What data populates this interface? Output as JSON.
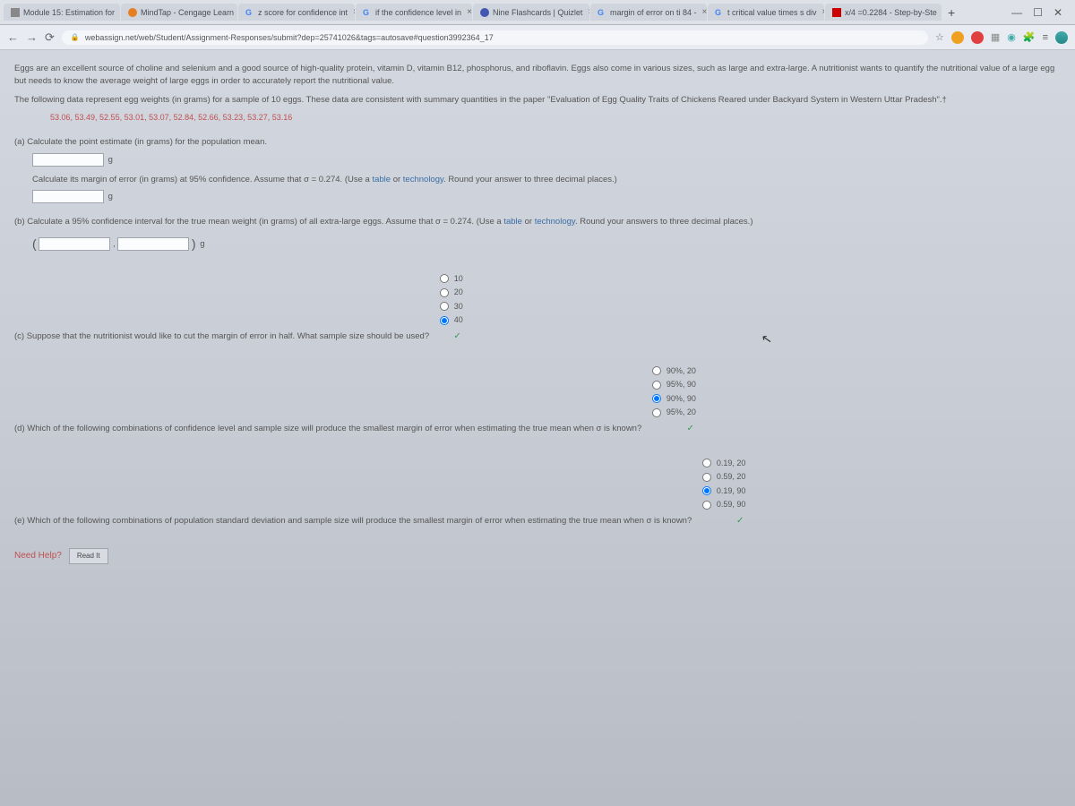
{
  "tabs": [
    {
      "label": "Module 15: Estimation for",
      "icon_color": "#888",
      "icon_shape": "square"
    },
    {
      "label": "MindTap - Cengage Learn",
      "icon_color": "#e67e22",
      "icon_shape": "star"
    },
    {
      "label": "z score for confidence int",
      "icon_color": "#4285f4",
      "icon_shape": "g"
    },
    {
      "label": "if the confidence level in",
      "icon_color": "#4285f4",
      "icon_shape": "g"
    },
    {
      "label": "Nine Flashcards | Quizlet",
      "icon_color": "#4257b2",
      "icon_shape": "q"
    },
    {
      "label": "margin of error on ti 84 -",
      "icon_color": "#4285f4",
      "icon_shape": "g"
    },
    {
      "label": "t critical value times s div",
      "icon_color": "#4285f4",
      "icon_shape": "g"
    },
    {
      "label": "x/4 =0.2284 - Step-by-Ste",
      "icon_color": "#cc0000",
      "icon_shape": "sy"
    }
  ],
  "url": "webassign.net/web/Student/Assignment-Responses/submit?dep=25741026&tags=autosave#question3992364_17",
  "intro": "Eggs are an excellent source of choline and selenium and a good source of high-quality protein, vitamin D, vitamin B12, phosphorus, and riboflavin. Eggs also come in various sizes, such as large and extra-large. A nutritionist wants to quantify the nutritional value of a large egg but needs to know the average weight of large eggs in order to accurately report the nutritional value.",
  "intro2": "The following data represent egg weights (in grams) for a sample of 10 eggs. These data are consistent with summary quantities in the paper \"Evaluation of Egg Quality Traits of Chickens Reared under Backyard System in Western Uttar Pradesh\".†",
  "data_line": "53.06, 53.49, 52.55, 53.01, 53.07, 52.84, 52.66, 53.23, 53.27, 53.16",
  "part_a": {
    "label": "(a)",
    "q1": "Calculate the point estimate (in grams) for the population mean.",
    "unit1": "g",
    "q2_prefix": "Calculate its margin of error (in grams) at 95% confidence. Assume that σ = 0.274. (Use a ",
    "link1": "table",
    "or": " or ",
    "link2": "technology",
    "q2_suffix": ". Round your answer to three decimal places.)",
    "unit2": "g"
  },
  "part_b": {
    "label": "(b)",
    "q_prefix": "Calculate a 95% confidence interval for the true mean weight (in grams) of all extra-large eggs. Assume that σ = 0.274. (Use a ",
    "link1": "table",
    "or": " or ",
    "link2": "technology",
    "q_suffix": ". Round your answers to three decimal places.)",
    "unit": "g"
  },
  "part_c": {
    "label": "(c)",
    "q": "Suppose that the nutritionist would like to cut the margin of error in half. What sample size should be used?",
    "opts": [
      "10",
      "20",
      "30",
      "40"
    ],
    "selected": 3
  },
  "part_d": {
    "label": "(d)",
    "q": "Which of the following combinations of confidence level and sample size will produce the smallest margin of error when estimating the true mean when σ is known?",
    "opts": [
      "90%, 20",
      "95%, 90",
      "90%, 90",
      "95%, 20"
    ],
    "selected": 2
  },
  "part_e": {
    "label": "(e)",
    "q": "Which of the following combinations of population standard deviation and sample size will produce the smallest margin of error when estimating the true mean when σ is known?",
    "opts": [
      "0.19, 20",
      "0.59, 20",
      "0.19, 90",
      "0.59, 90"
    ],
    "selected": 2
  },
  "need_help": "Need Help?",
  "read_it": "Read It"
}
